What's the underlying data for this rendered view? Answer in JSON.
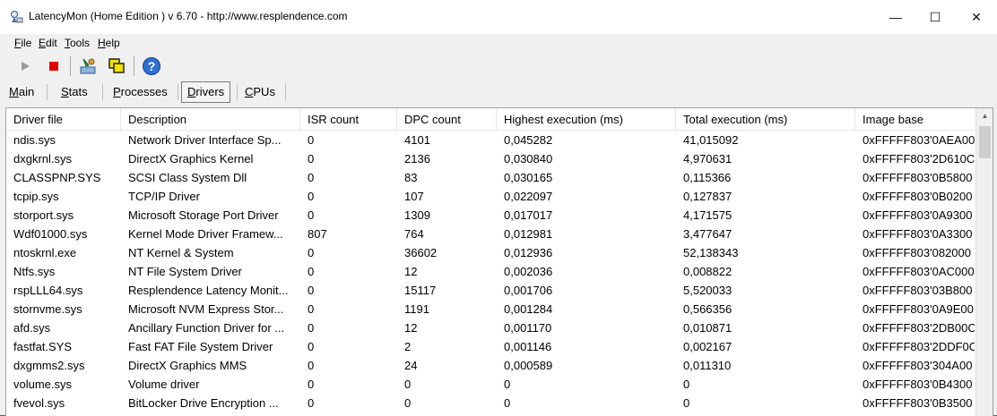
{
  "window": {
    "title": "LatencyMon  (Home Edition )  v 6.70 - http://www.resplendence.com",
    "minimize_glyph": "—",
    "maximize_glyph": "☐",
    "close_glyph": "✕"
  },
  "menu": [
    {
      "key": "F",
      "rest": "ile"
    },
    {
      "key": "E",
      "rest": "dit"
    },
    {
      "key": "T",
      "rest": "ools"
    },
    {
      "key": "H",
      "rest": "elp"
    }
  ],
  "tabs": [
    {
      "key": "M",
      "rest": "ain",
      "active": false
    },
    {
      "key": "S",
      "rest": "tats",
      "active": false
    },
    {
      "key": "P",
      "rest": "rocesses",
      "active": false
    },
    {
      "key": "D",
      "rest": "rivers",
      "active": true
    },
    {
      "key": "C",
      "rest": "PUs",
      "active": false
    }
  ],
  "colors": {
    "stop": "#e00000",
    "help": "#2f6fd6",
    "titlebar": "#ffffff",
    "window": "#f0f0f0"
  },
  "icons": [
    "start-icon",
    "stop-icon",
    "processes-tool-icon",
    "windows-tool-icon",
    "help-icon"
  ],
  "table": {
    "columns": [
      "Driver file",
      "Description",
      "ISR count",
      "DPC count",
      "Highest execution (ms)",
      "Total execution (ms)",
      "Image base"
    ],
    "rows": [
      [
        "ndis.sys",
        "Network Driver Interface Sp...",
        "0",
        "4101",
        "0,045282",
        "41,015092",
        "0xFFFFF803'0AEA00"
      ],
      [
        "dxgkrnl.sys",
        "DirectX Graphics Kernel",
        "0",
        "2136",
        "0,030840",
        "4,970631",
        "0xFFFFF803'2D610C"
      ],
      [
        "CLASSPNP.SYS",
        "SCSI Class System Dll",
        "0",
        "83",
        "0,030165",
        "0,115366",
        "0xFFFFF803'0B5800"
      ],
      [
        "tcpip.sys",
        "TCP/IP Driver",
        "0",
        "107",
        "0,022097",
        "0,127837",
        "0xFFFFF803'0B0200"
      ],
      [
        "storport.sys",
        "Microsoft Storage Port Driver",
        "0",
        "1309",
        "0,017017",
        "4,171575",
        "0xFFFFF803'0A9300"
      ],
      [
        "Wdf01000.sys",
        "Kernel Mode Driver Framew...",
        "807",
        "764",
        "0,012981",
        "3,477647",
        "0xFFFFF803'0A3300"
      ],
      [
        "ntoskrnl.exe",
        "NT Kernel & System",
        "0",
        "36602",
        "0,012936",
        "52,138343",
        "0xFFFFF803'082000"
      ],
      [
        "Ntfs.sys",
        "NT File System Driver",
        "0",
        "12",
        "0,002036",
        "0,008822",
        "0xFFFFF803'0AC000"
      ],
      [
        "rspLLL64.sys",
        "Resplendence Latency Monit...",
        "0",
        "15117",
        "0,001706",
        "5,520033",
        "0xFFFFF803'03B800"
      ],
      [
        "stornvme.sys",
        "Microsoft NVM Express Stor...",
        "0",
        "1191",
        "0,001284",
        "0,566356",
        "0xFFFFF803'0A9E00"
      ],
      [
        "afd.sys",
        "Ancillary Function Driver for ...",
        "0",
        "12",
        "0,001170",
        "0,010871",
        "0xFFFFF803'2DB00C"
      ],
      [
        "fastfat.SYS",
        "Fast FAT File System Driver",
        "0",
        "2",
        "0,001146",
        "0,002167",
        "0xFFFFF803'2DDF0C"
      ],
      [
        "dxgmms2.sys",
        "DirectX Graphics MMS",
        "0",
        "24",
        "0,000589",
        "0,011310",
        "0xFFFFF803'304A00"
      ],
      [
        "volume.sys",
        "Volume driver",
        "0",
        "0",
        "0",
        "0",
        "0xFFFFF803'0B4300"
      ],
      [
        "fvevol.sys",
        "BitLocker Drive Encryption ...",
        "0",
        "0",
        "0",
        "0",
        "0xFFFFF803'0B3500"
      ]
    ]
  }
}
